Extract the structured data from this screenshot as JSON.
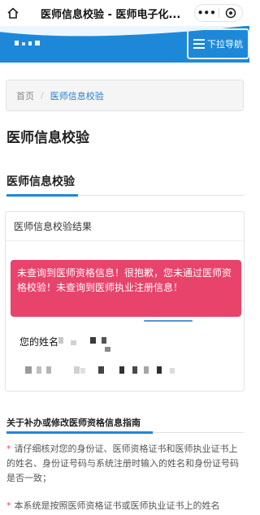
{
  "wechat_bar": {
    "title": "医师信息校验 - 医师电子化...",
    "more": "•••"
  },
  "header": {
    "nav_toggle_label": "下拉导航",
    "brand_color": "#1e88d8"
  },
  "breadcrumb": {
    "home": "首页",
    "separator": "/",
    "current": "医师信息校验"
  },
  "page_title": "医师信息校验",
  "section_title": "医师信息校验",
  "result_card": {
    "heading": "医师信息校验结果",
    "alert_text": "未查询到医师资格信息！很抱歉，您未通过医师资格校验！未查询到医师执业注册信息！",
    "alert_color": "#e8436b",
    "name_label": "您的姓名"
  },
  "guide": {
    "title": "关于补办或修改医师资格信息指南",
    "items": [
      {
        "star": "*",
        "text": "请仔细核对您的身份证、医师资格证书和医师执业证书上的姓名、身份证号码与系统注册时输入的姓名和身份证号码是否一致；"
      },
      {
        "star": "*",
        "text": "本系统是按照医师资格证书或医师执业证书上的姓名"
      }
    ]
  }
}
